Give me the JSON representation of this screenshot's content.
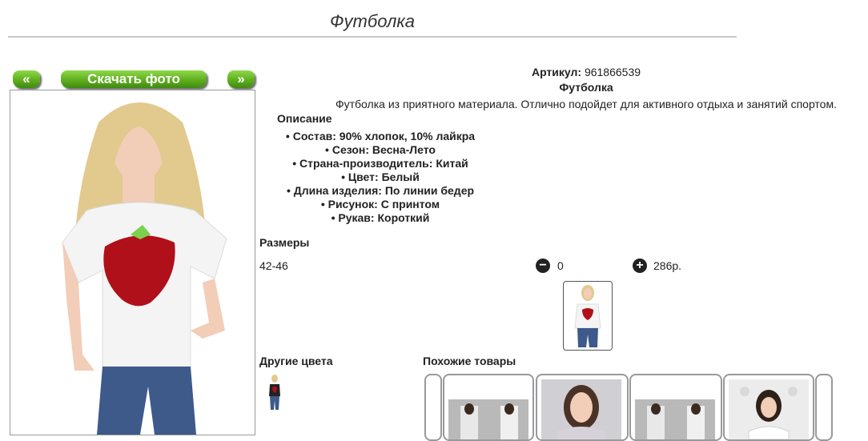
{
  "page": {
    "title": "Футболка"
  },
  "gallery": {
    "prev_label": "«",
    "download_label": "Скачать фото",
    "next_label": "»"
  },
  "product": {
    "article_label": "Артикул:",
    "article_value": "961866539",
    "name": "Футболка",
    "description": "Футболка из приятного материала. Отлично подойдет для активного отдыха и занятий спортом.",
    "description_heading": "Описание",
    "features": [
      "Состав: 90% хлопок, 10% лайкра",
      "Сезон: Весна-Лето",
      "Страна-производитель: Китай",
      "Цвет: Белый",
      "Длина изделия: По линии бедер",
      "Рисунок: С принтом",
      "Рукав: Короткий"
    ]
  },
  "sizes": {
    "heading": "Размеры",
    "size": "42-46",
    "minus_label": "−",
    "quantity": "0",
    "plus_label": "+",
    "price": "286р."
  },
  "other_colors": {
    "heading": "Другие цвета"
  },
  "similar": {
    "heading": "Похожие товары"
  },
  "colors": {
    "button_green": "#5fae1e",
    "shirt": "#ffffff",
    "strawberry": "#b0101a",
    "jeans": "#3d5a8a",
    "hair": "#e2c98e",
    "skin": "#f2cdb7"
  }
}
